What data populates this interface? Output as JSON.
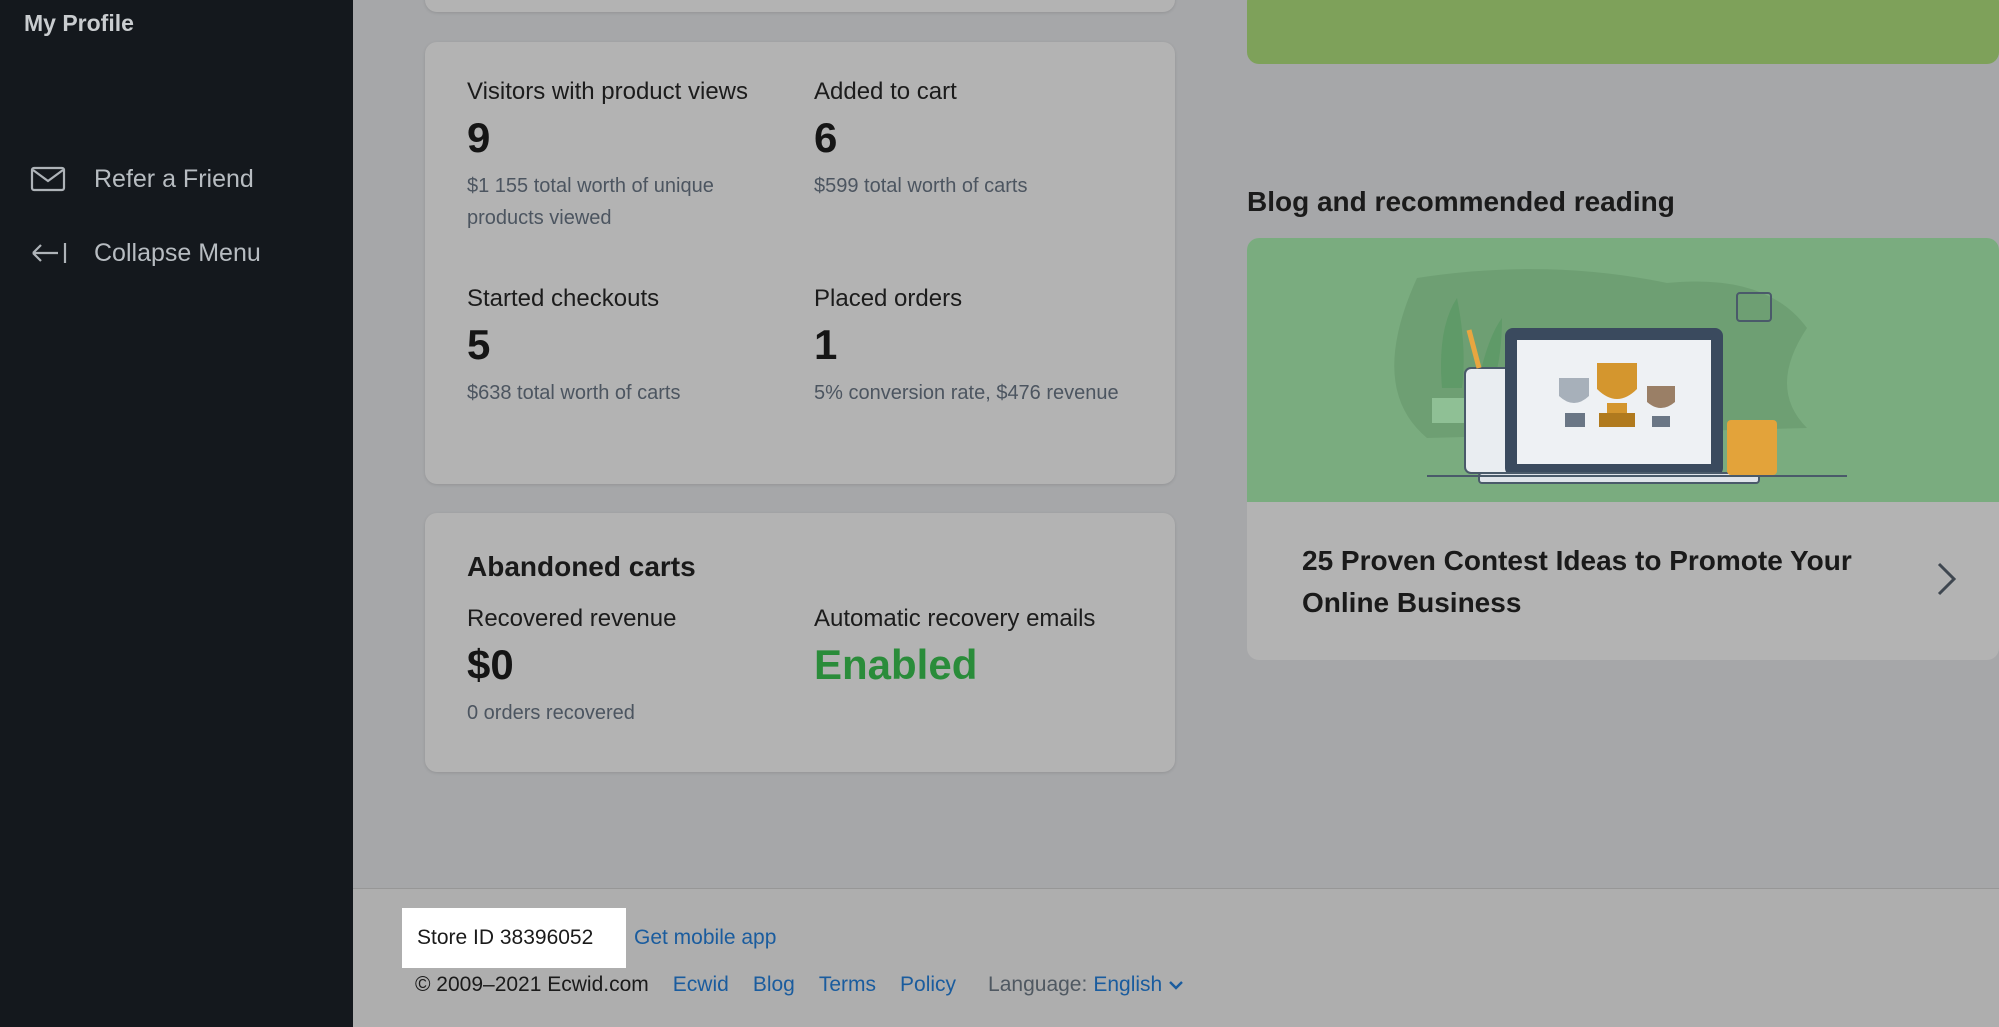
{
  "sidebar": {
    "profile": "My Profile",
    "items": [
      {
        "label": "Refer a Friend",
        "icon": "envelope-icon"
      },
      {
        "label": "Collapse Menu",
        "icon": "collapse-arrow-icon"
      }
    ]
  },
  "stats": {
    "visitors": {
      "label": "Visitors with product views",
      "value": "9",
      "desc": "$1 155 total worth of unique products viewed"
    },
    "added": {
      "label": "Added to cart",
      "value": "6",
      "desc": "$599 total worth of carts"
    },
    "checkouts": {
      "label": "Started checkouts",
      "value": "5",
      "desc": "$638 total worth of carts"
    },
    "orders": {
      "label": "Placed orders",
      "value": "1",
      "desc": "5% conversion rate, $476 revenue"
    }
  },
  "abandoned": {
    "title": "Abandoned carts",
    "recovered": {
      "label": "Recovered revenue",
      "value": "$0",
      "desc": "0 orders recovered"
    },
    "emails": {
      "label": "Automatic recovery emails",
      "value": "Enabled"
    }
  },
  "blog": {
    "heading": "Blog and recommended reading",
    "article_title": "25 Proven Contest Ideas to Promote Your Online Business",
    "image_icon": "trophies-laptop-illustration"
  },
  "footer": {
    "store_id": "Store ID 38396052",
    "get_app": "Get mobile app",
    "copyright": "© 2009–2021 Ecwid.com",
    "links": [
      "Ecwid",
      "Blog",
      "Terms",
      "Policy"
    ],
    "language_label": "Language:",
    "language_value": "English"
  },
  "colors": {
    "sidebar_bg": "#14181d",
    "enabled_green": "#2a8c3a",
    "link_blue": "#1a5c9e",
    "banner_green": "#7ea15a"
  }
}
